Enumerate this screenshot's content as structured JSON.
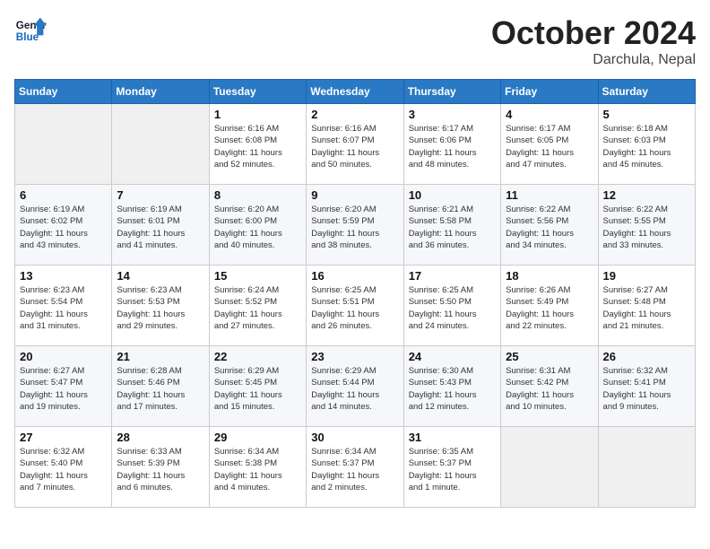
{
  "header": {
    "logo_general": "General",
    "logo_blue": "Blue",
    "month": "October 2024",
    "location": "Darchula, Nepal"
  },
  "weekdays": [
    "Sunday",
    "Monday",
    "Tuesday",
    "Wednesday",
    "Thursday",
    "Friday",
    "Saturday"
  ],
  "weeks": [
    [
      {
        "day": "",
        "detail": ""
      },
      {
        "day": "",
        "detail": ""
      },
      {
        "day": "1",
        "detail": "Sunrise: 6:16 AM\nSunset: 6:08 PM\nDaylight: 11 hours\nand 52 minutes."
      },
      {
        "day": "2",
        "detail": "Sunrise: 6:16 AM\nSunset: 6:07 PM\nDaylight: 11 hours\nand 50 minutes."
      },
      {
        "day": "3",
        "detail": "Sunrise: 6:17 AM\nSunset: 6:06 PM\nDaylight: 11 hours\nand 48 minutes."
      },
      {
        "day": "4",
        "detail": "Sunrise: 6:17 AM\nSunset: 6:05 PM\nDaylight: 11 hours\nand 47 minutes."
      },
      {
        "day": "5",
        "detail": "Sunrise: 6:18 AM\nSunset: 6:03 PM\nDaylight: 11 hours\nand 45 minutes."
      }
    ],
    [
      {
        "day": "6",
        "detail": "Sunrise: 6:19 AM\nSunset: 6:02 PM\nDaylight: 11 hours\nand 43 minutes."
      },
      {
        "day": "7",
        "detail": "Sunrise: 6:19 AM\nSunset: 6:01 PM\nDaylight: 11 hours\nand 41 minutes."
      },
      {
        "day": "8",
        "detail": "Sunrise: 6:20 AM\nSunset: 6:00 PM\nDaylight: 11 hours\nand 40 minutes."
      },
      {
        "day": "9",
        "detail": "Sunrise: 6:20 AM\nSunset: 5:59 PM\nDaylight: 11 hours\nand 38 minutes."
      },
      {
        "day": "10",
        "detail": "Sunrise: 6:21 AM\nSunset: 5:58 PM\nDaylight: 11 hours\nand 36 minutes."
      },
      {
        "day": "11",
        "detail": "Sunrise: 6:22 AM\nSunset: 5:56 PM\nDaylight: 11 hours\nand 34 minutes."
      },
      {
        "day": "12",
        "detail": "Sunrise: 6:22 AM\nSunset: 5:55 PM\nDaylight: 11 hours\nand 33 minutes."
      }
    ],
    [
      {
        "day": "13",
        "detail": "Sunrise: 6:23 AM\nSunset: 5:54 PM\nDaylight: 11 hours\nand 31 minutes."
      },
      {
        "day": "14",
        "detail": "Sunrise: 6:23 AM\nSunset: 5:53 PM\nDaylight: 11 hours\nand 29 minutes."
      },
      {
        "day": "15",
        "detail": "Sunrise: 6:24 AM\nSunset: 5:52 PM\nDaylight: 11 hours\nand 27 minutes."
      },
      {
        "day": "16",
        "detail": "Sunrise: 6:25 AM\nSunset: 5:51 PM\nDaylight: 11 hours\nand 26 minutes."
      },
      {
        "day": "17",
        "detail": "Sunrise: 6:25 AM\nSunset: 5:50 PM\nDaylight: 11 hours\nand 24 minutes."
      },
      {
        "day": "18",
        "detail": "Sunrise: 6:26 AM\nSunset: 5:49 PM\nDaylight: 11 hours\nand 22 minutes."
      },
      {
        "day": "19",
        "detail": "Sunrise: 6:27 AM\nSunset: 5:48 PM\nDaylight: 11 hours\nand 21 minutes."
      }
    ],
    [
      {
        "day": "20",
        "detail": "Sunrise: 6:27 AM\nSunset: 5:47 PM\nDaylight: 11 hours\nand 19 minutes."
      },
      {
        "day": "21",
        "detail": "Sunrise: 6:28 AM\nSunset: 5:46 PM\nDaylight: 11 hours\nand 17 minutes."
      },
      {
        "day": "22",
        "detail": "Sunrise: 6:29 AM\nSunset: 5:45 PM\nDaylight: 11 hours\nand 15 minutes."
      },
      {
        "day": "23",
        "detail": "Sunrise: 6:29 AM\nSunset: 5:44 PM\nDaylight: 11 hours\nand 14 minutes."
      },
      {
        "day": "24",
        "detail": "Sunrise: 6:30 AM\nSunset: 5:43 PM\nDaylight: 11 hours\nand 12 minutes."
      },
      {
        "day": "25",
        "detail": "Sunrise: 6:31 AM\nSunset: 5:42 PM\nDaylight: 11 hours\nand 10 minutes."
      },
      {
        "day": "26",
        "detail": "Sunrise: 6:32 AM\nSunset: 5:41 PM\nDaylight: 11 hours\nand 9 minutes."
      }
    ],
    [
      {
        "day": "27",
        "detail": "Sunrise: 6:32 AM\nSunset: 5:40 PM\nDaylight: 11 hours\nand 7 minutes."
      },
      {
        "day": "28",
        "detail": "Sunrise: 6:33 AM\nSunset: 5:39 PM\nDaylight: 11 hours\nand 6 minutes."
      },
      {
        "day": "29",
        "detail": "Sunrise: 6:34 AM\nSunset: 5:38 PM\nDaylight: 11 hours\nand 4 minutes."
      },
      {
        "day": "30",
        "detail": "Sunrise: 6:34 AM\nSunset: 5:37 PM\nDaylight: 11 hours\nand 2 minutes."
      },
      {
        "day": "31",
        "detail": "Sunrise: 6:35 AM\nSunset: 5:37 PM\nDaylight: 11 hours\nand 1 minute."
      },
      {
        "day": "",
        "detail": ""
      },
      {
        "day": "",
        "detail": ""
      }
    ]
  ]
}
